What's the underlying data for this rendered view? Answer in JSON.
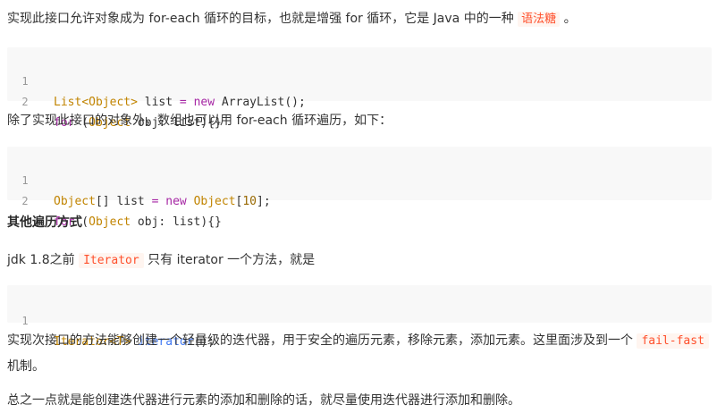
{
  "paragraphs": {
    "p1_text": "实现此接口允许对象成为 for-each 循环的目标，也就是增强 for 循环，它是 Java 中的一种 ",
    "p1_tag": "语法糖",
    "p1_end": " 。",
    "p2_text": "除了实现此接口的对象外，数组也可以用 for-each 循环遍历，如下：",
    "p3_pre": "jdk 1.8之前 ",
    "p3_code": "Iterator",
    "p3_post": " 只有 iterator 一个方法，就是",
    "p4_text": "实现次接口的方法能够创建一个轻量级的迭代器，用于安全的遍历元素，移除元素，添加元素。这里面涉及到一个 ",
    "p4_code": "fail-fast",
    "p4_end": " 机制。",
    "p5_text": "总之一点就是能创建迭代器进行元素的添加和删除的话，就尽量使用迭代器进行添加和删除。"
  },
  "heading": {
    "text": "其他遍历方式"
  },
  "code_blocks": {
    "block1": {
      "line_numbers": [
        "1",
        "2"
      ],
      "l1": {
        "a": "List",
        "b": "<Object>",
        "c": " list ",
        "d": "=",
        "e": " ",
        "f": "new",
        "g": " ArrayList();"
      },
      "l2": {
        "a": "for",
        "b": " (",
        "c": "Object",
        "d": " obj: list){}"
      }
    },
    "block2": {
      "line_numbers": [
        "1",
        "2"
      ],
      "l1": {
        "a": "Object",
        "b": "[] list ",
        "c": "=",
        "d": " ",
        "e": "new",
        "f": " ",
        "g": "Object",
        "h": "[",
        "i": "10",
        "j": "];"
      },
      "l2": {
        "a": "for",
        "b": " (",
        "c": "Object",
        "d": " obj: list){}"
      }
    },
    "block3": {
      "line_numbers": [
        "1"
      ],
      "l1": {
        "a": "Iterator",
        "b": "<T>",
        "c": " ",
        "d": "iterator",
        "e": "();"
      }
    }
  },
  "colors": {
    "text": "#333333",
    "code_bg": "#f8f8f8",
    "inline_code_bg": "#fff5f0",
    "inline_code_fg": "#ff502c",
    "keyword": "#a626a4",
    "type": "#c18401",
    "function": "#4078f2",
    "number": "#986801",
    "line_number": "#999999"
  }
}
